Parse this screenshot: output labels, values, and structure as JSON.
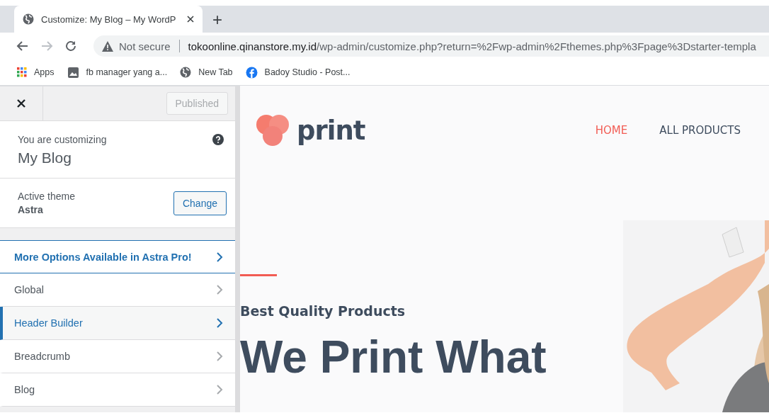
{
  "browser": {
    "tab": {
      "title": "Customize: My Blog – My WordP"
    },
    "new_tab": "+",
    "address": {
      "security": "Not secure",
      "host": "tokoonline.qinanstore.my.id",
      "path": "/wp-admin/customize.php?return=%2Fwp-admin%2Fthemes.php%3Fpage%3Dstarter-templa"
    },
    "bookmarks": [
      {
        "label": "Apps",
        "kind": "apps"
      },
      {
        "label": "fb manager yang a...",
        "kind": "page"
      },
      {
        "label": "New Tab",
        "kind": "globe"
      },
      {
        "label": "Badoy Studio - Post...",
        "kind": "facebook"
      }
    ]
  },
  "customizer": {
    "publish_button": {
      "label": "Published",
      "disabled": true
    },
    "customizing_label": "You are customizing",
    "site_title": "My Blog",
    "theme_label": "Active theme",
    "theme_name": "Astra",
    "change_button": "Change",
    "sections": [
      {
        "label": "More Options Available in Astra Pro!",
        "kind": "promo",
        "selected": false
      },
      {
        "label": "Global",
        "kind": "section",
        "selected": false
      },
      {
        "label": "Header Builder",
        "kind": "section",
        "selected": true
      },
      {
        "label": "Breadcrumb",
        "kind": "section",
        "selected": false
      },
      {
        "label": "Blog",
        "kind": "section",
        "selected": false
      }
    ]
  },
  "preview": {
    "logo": "print",
    "nav": [
      {
        "label": "HOME",
        "selected": true
      },
      {
        "label": "ALL PRODUCTS",
        "selected": false
      }
    ],
    "eyebrow": "Best Quality Products",
    "headline": "We Print What"
  }
}
